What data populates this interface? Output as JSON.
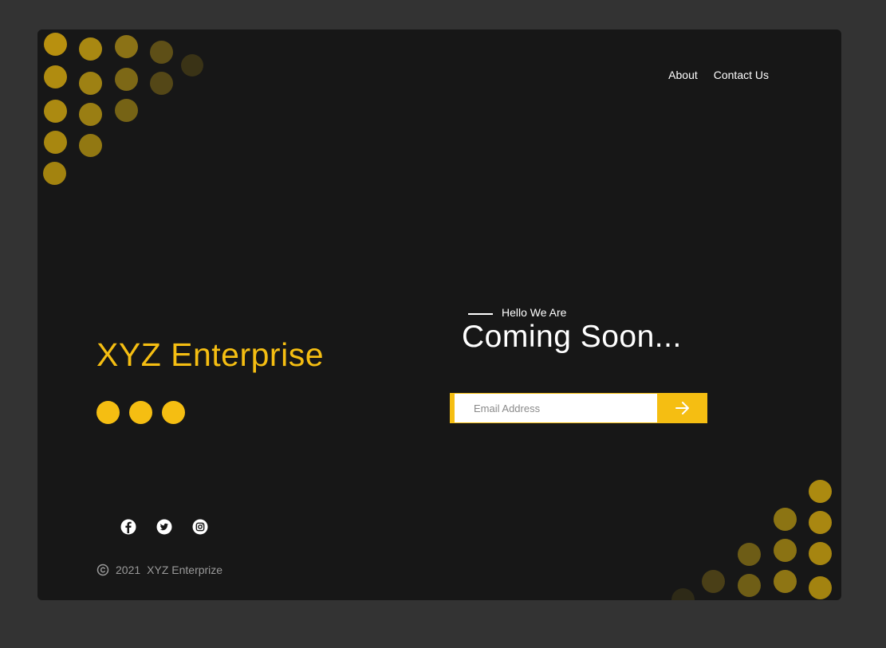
{
  "nav": {
    "items": [
      {
        "label": "About"
      },
      {
        "label": "Contact Us"
      }
    ]
  },
  "hero": {
    "brand": "XYZ Enterprise",
    "eyebrow": "Hello We Are",
    "headline": "Coming Soon..."
  },
  "subscribe": {
    "placeholder": "Email Address",
    "submit_icon": "arrow-right-icon"
  },
  "social": {
    "icons": [
      "facebook-icon",
      "twitter-icon",
      "instagram-icon"
    ]
  },
  "footer": {
    "copyright_icon": "copyright-icon",
    "year": "2021",
    "company": "XYZ Enterprize"
  },
  "colors": {
    "background": "#333333",
    "card": "#171717",
    "accent": "#F5BE12",
    "text": "#FFFFFF",
    "muted": "#9A9A9A"
  }
}
